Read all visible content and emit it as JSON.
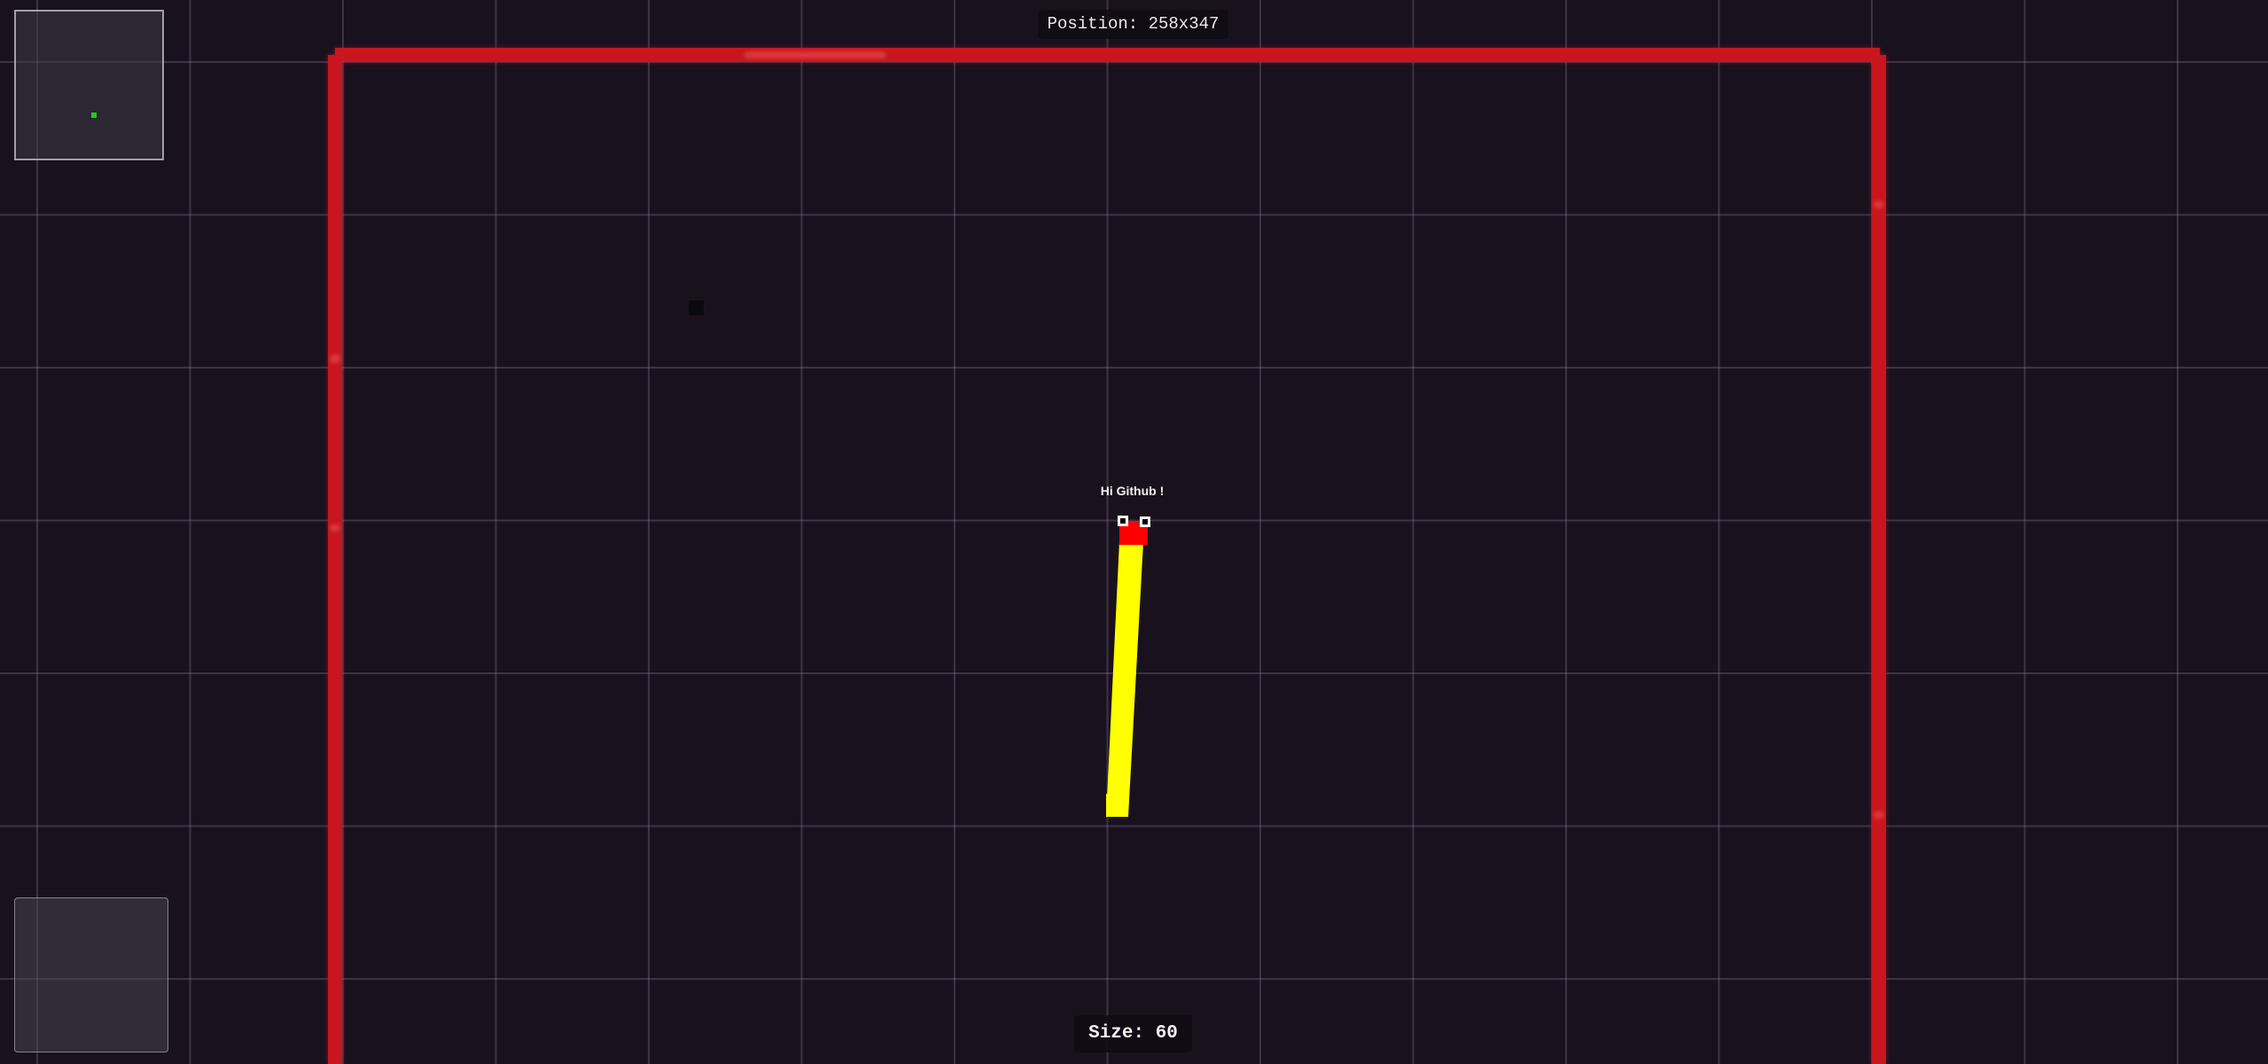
{
  "hud": {
    "position_text": "Position: 258x347",
    "size_label": "Size:",
    "size_value": "60"
  },
  "player": {
    "name": "Hi Github !",
    "body_color": "#ffff00",
    "head_color": "#ff0000",
    "eye_color": "#ffffff",
    "pupil_color": "#000000"
  },
  "colors": {
    "background": "#1a111e",
    "grid_line": "#5f5a6e",
    "wall": "#c8161f",
    "minimap_dot": "#16d416",
    "food": "#0a0a0e"
  },
  "icons": {
    "minimap": "minimap-panel",
    "joystick": "joystick-panel"
  }
}
